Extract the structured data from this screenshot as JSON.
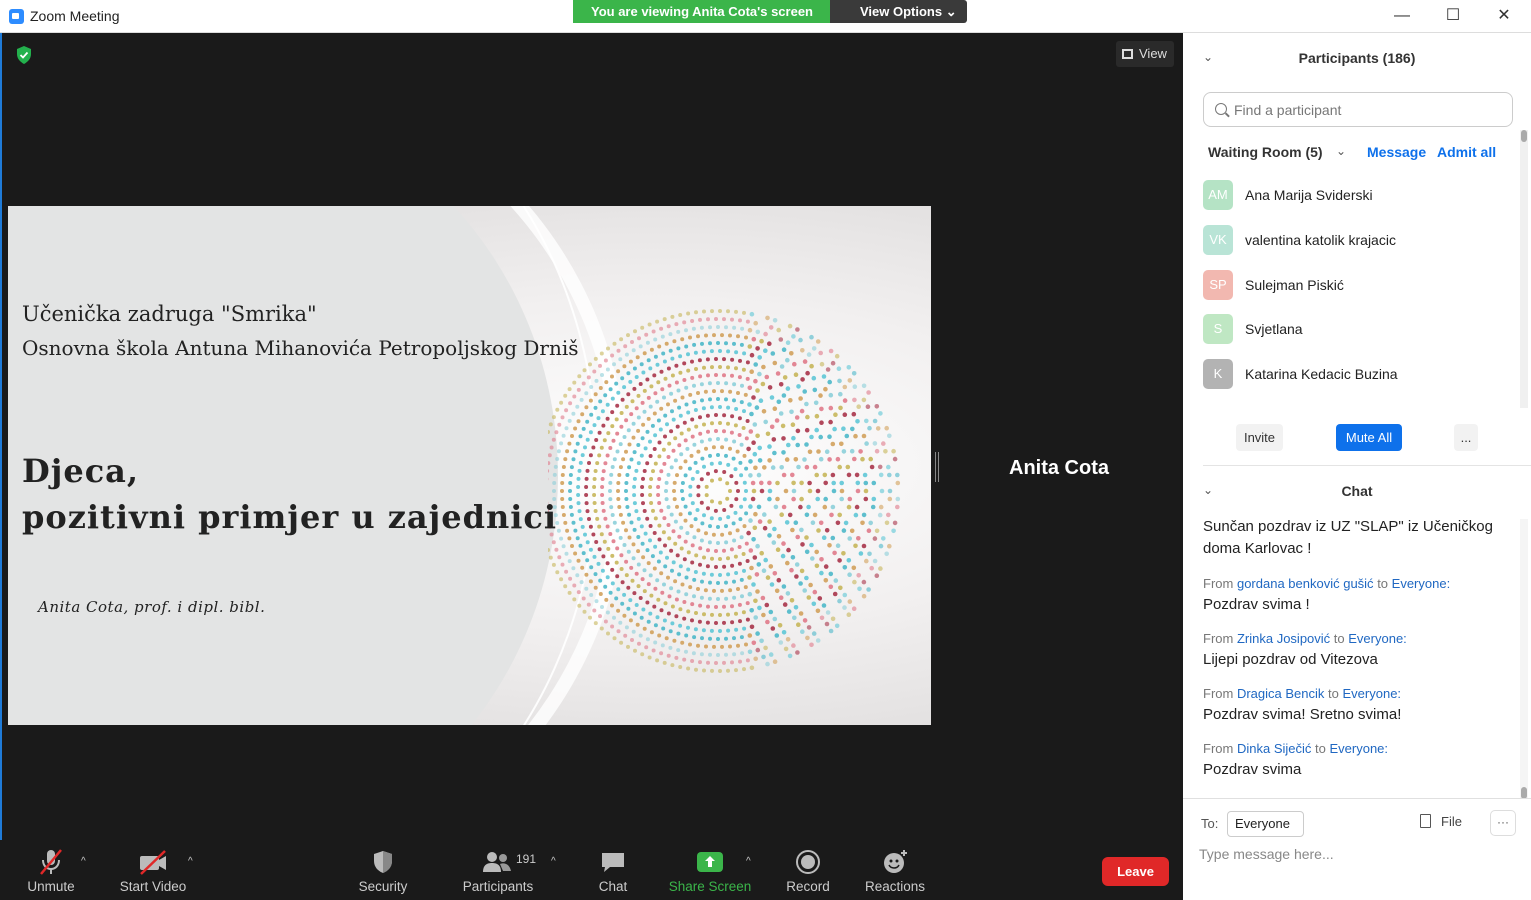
{
  "window": {
    "title": "Zoom Meeting",
    "minimize": "—",
    "maximize": "☐",
    "close": "✕"
  },
  "banner": {
    "viewing_text": "You are viewing Anita Cota's screen",
    "view_options": "View Options ⌄"
  },
  "stage": {
    "view_label": "View",
    "presenter_name": "Anita Cota"
  },
  "slide": {
    "school_line1": "Učenička zadruga \"Smrika\"",
    "school_line2": "Osnovna škola Antuna Mihanovića Petropoljskog Drniš",
    "heading_line1": "Djeca,",
    "heading_line2": "pozitivni primjer u zajednici",
    "author": "Anita Cota, prof. i dipl. bibl."
  },
  "toolbar": {
    "unmute": "Unmute",
    "start_video": "Start Video",
    "security": "Security",
    "participants": "Participants",
    "participant_count": "191",
    "chat": "Chat",
    "share_screen": "Share Screen",
    "record": "Record",
    "reactions": "Reactions",
    "leave": "Leave"
  },
  "participants_panel": {
    "title": "Participants (186)",
    "search_placeholder": "Find a participant",
    "waiting_room": "Waiting Room (5)",
    "message": "Message",
    "admit_all": "Admit all",
    "waiting": [
      {
        "initials": "AM",
        "name": "Ana Marija Sviderski",
        "color": "#b5e3c5"
      },
      {
        "initials": "VK",
        "name": "valentina katolik krajacic",
        "color": "#b9e4d6"
      },
      {
        "initials": "SP",
        "name": "Sulejman Piskić",
        "color": "#f2b8b0"
      },
      {
        "initials": "S",
        "name": "Svjetlana",
        "color": "#bfe7c3"
      },
      {
        "initials": "K",
        "name": "Katarina Kedacic Buzina",
        "color": "#b3b3b3"
      }
    ],
    "invite": "Invite",
    "mute_all": "Mute All",
    "more": "..."
  },
  "chat_panel": {
    "title": "Chat",
    "messages": [
      {
        "from": "",
        "to": "",
        "text": "Sunčan pozdrav iz UZ \"SLAP\" iz Učeničkog doma Karlovac !"
      },
      {
        "from": "gordana benković gušić",
        "to": "Everyone:",
        "text": "Pozdrav svima !"
      },
      {
        "from": "Zrinka Josipović",
        "to": "Everyone:",
        "text": "Lijepi pozdrav od Vitezova"
      },
      {
        "from": "Dragica Bencik",
        "to": "Everyone:",
        "text": "Pozdrav svima! Sretno svima!"
      },
      {
        "from": "Dinka Siječić",
        "to": "Everyone:",
        "text": "Pozdrav svima"
      }
    ],
    "from_word": "From",
    "to_word": "to",
    "to_label": "To:",
    "recipient": "Everyone ⌄",
    "file": "File",
    "more": "···",
    "input_placeholder": "Type message here..."
  },
  "colors": {
    "accent": "#0e71eb",
    "leave": "#e02828",
    "share": "#3bb54a",
    "banner": "#3bb54a"
  }
}
